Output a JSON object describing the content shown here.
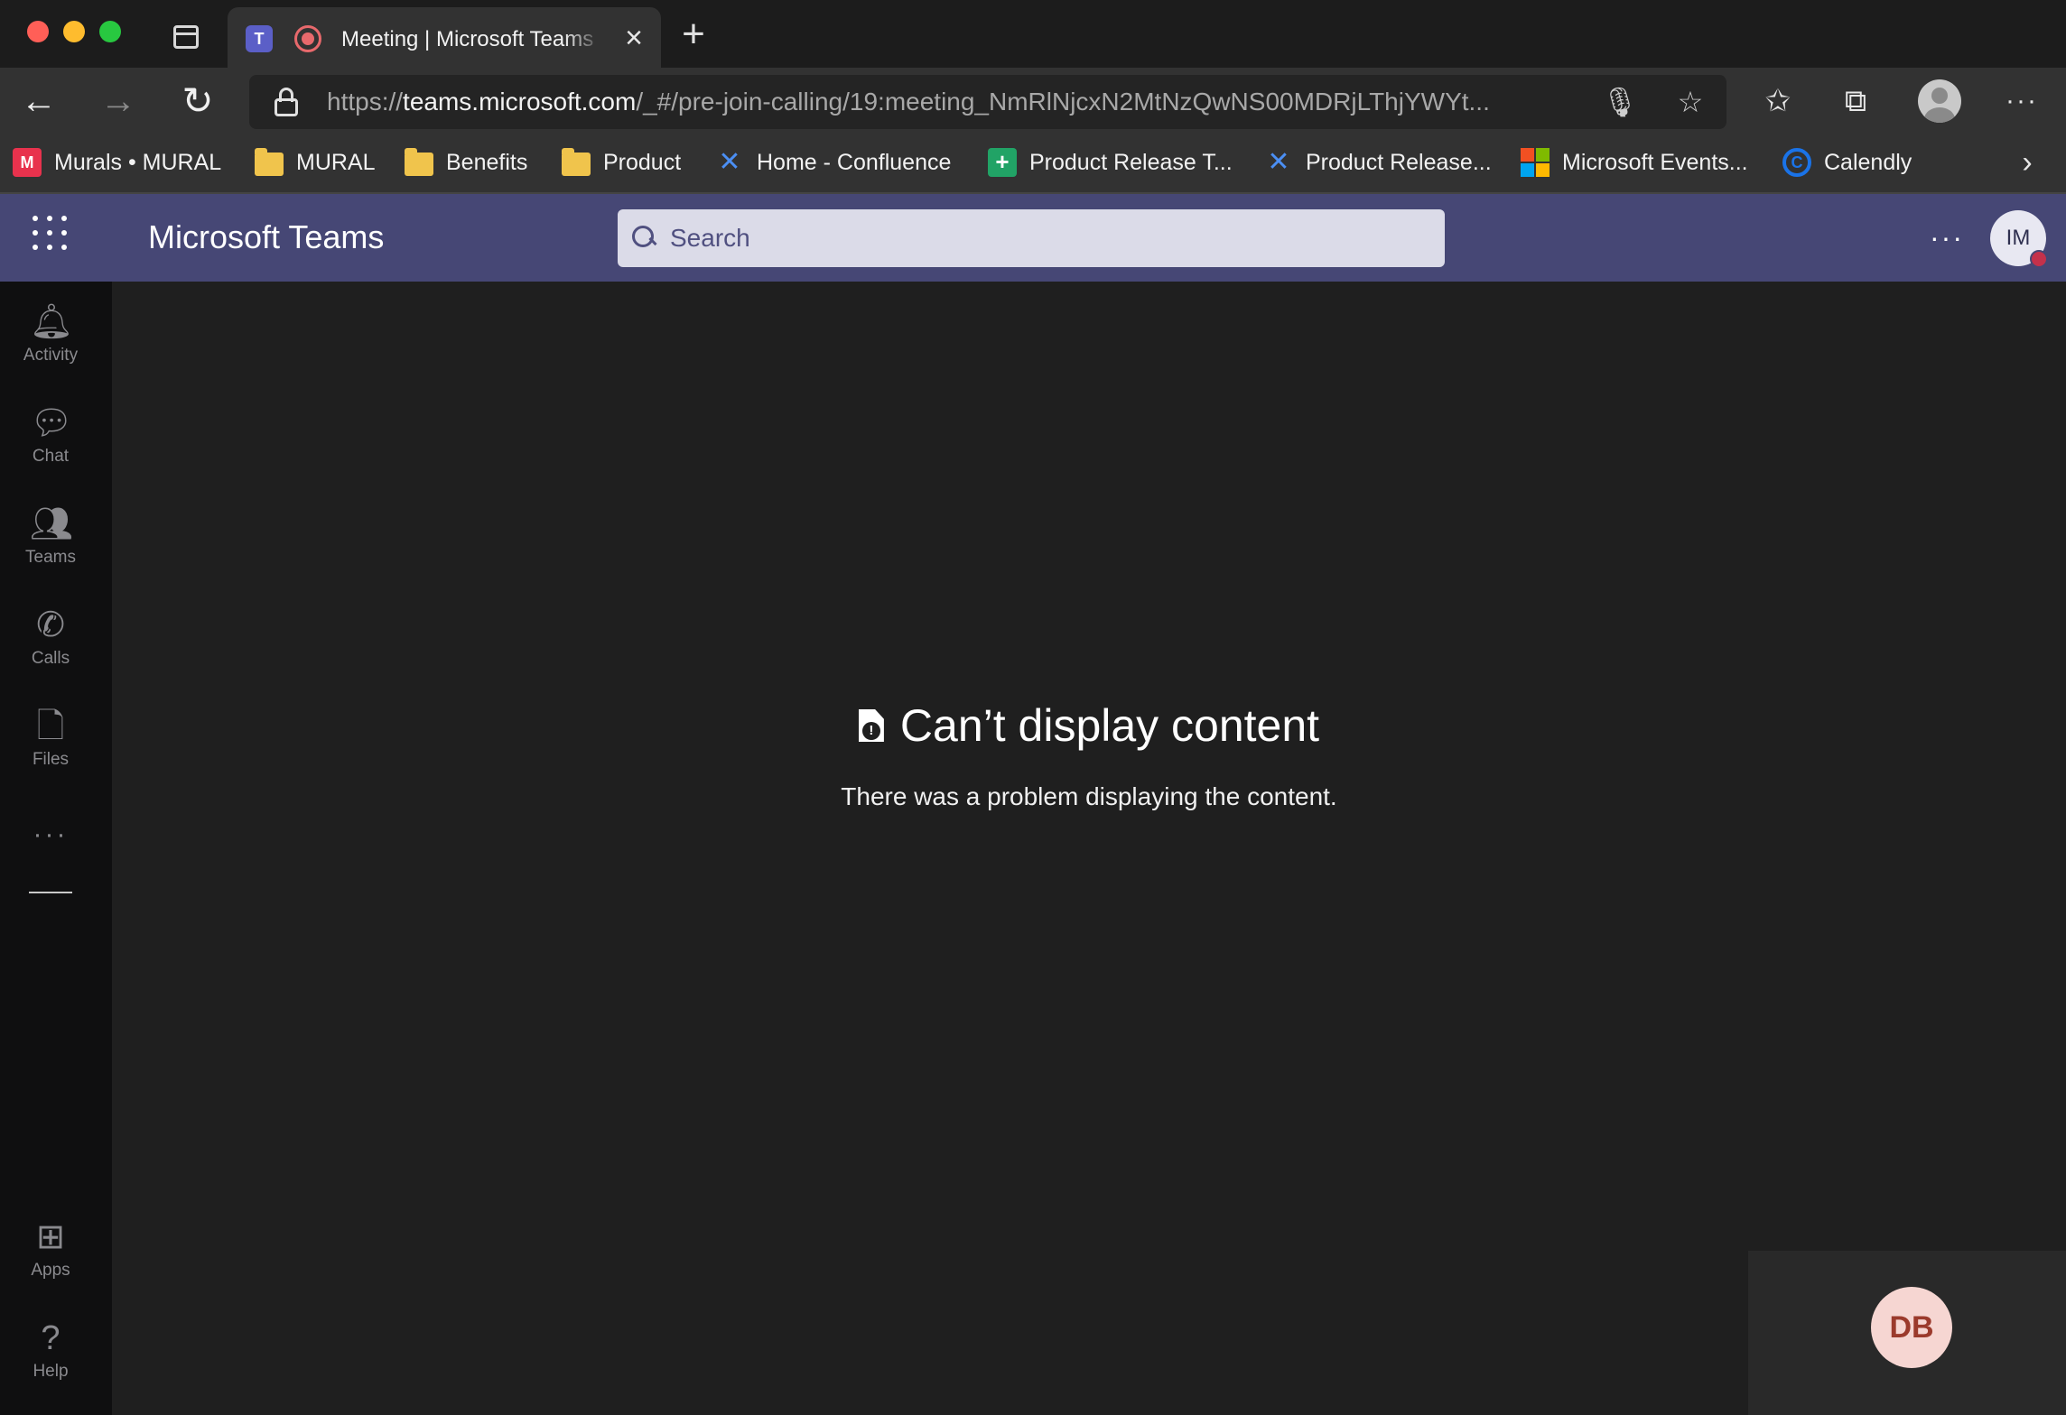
{
  "browser": {
    "tab_title": "Meeting | Microsoft Teams",
    "url_scheme": "https://",
    "url_host": "teams.microsoft.com",
    "url_path": "/_#/pre-join-calling/19:meeting_NmRlNjcxN2MtNzQwNS00MDRjLThjYWYt..."
  },
  "favorites": [
    {
      "label": "Murals • MURAL",
      "icon": "mural-icon"
    },
    {
      "label": "MURAL",
      "icon": "folder-icon"
    },
    {
      "label": "Benefits",
      "icon": "folder-icon"
    },
    {
      "label": "Product",
      "icon": "folder-icon"
    },
    {
      "label": "Home - Confluence",
      "icon": "confluence-icon"
    },
    {
      "label": "Product Release T...",
      "icon": "sheets-icon"
    },
    {
      "label": "Product Release...",
      "icon": "confluence-icon"
    },
    {
      "label": "Microsoft Events...",
      "icon": "microsoft-icon"
    },
    {
      "label": "Calendly",
      "icon": "calendly-icon"
    }
  ],
  "teams": {
    "app_title": "Microsoft Teams",
    "search_placeholder": "Search",
    "user_initials": "IM",
    "presence_color": "#c4314b",
    "header_color": "#464775"
  },
  "rail": [
    {
      "label": "Activity",
      "icon": "bell-icon"
    },
    {
      "label": "Chat",
      "icon": "chat-icon"
    },
    {
      "label": "Teams",
      "icon": "teams-icon"
    },
    {
      "label": "Calls",
      "icon": "phone-icon"
    },
    {
      "label": "Files",
      "icon": "file-icon"
    },
    {
      "label": "Apps",
      "icon": "apps-icon"
    },
    {
      "label": "Help",
      "icon": "help-icon"
    }
  ],
  "error": {
    "title": "Can’t display content",
    "message": "There was a problem displaying the content."
  },
  "participant": {
    "initials": "DB"
  }
}
